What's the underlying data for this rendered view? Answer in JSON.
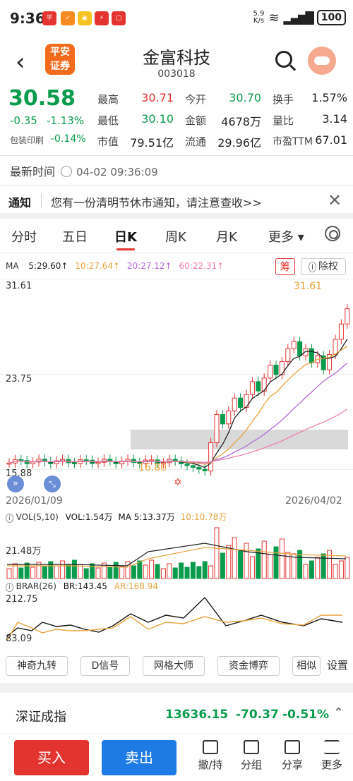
{
  "status": {
    "time": "9:36",
    "net": "5.9\nK/s",
    "battery": "100"
  },
  "header": {
    "logo": "平安\n证券",
    "title": "金富科技",
    "code": "003018"
  },
  "quote": {
    "price": "30.58",
    "change": "-0.35",
    "change_pct": "-1.13%",
    "wrap_label": "包装印刷",
    "wrap_value": "-0.14%",
    "fields": [
      {
        "label": "最高",
        "value": "30.71"
      },
      {
        "label": "今开",
        "value": "30.70"
      },
      {
        "label": "换手",
        "value": "1.57%"
      },
      {
        "label": "最低",
        "value": "30.10"
      },
      {
        "label": "金额",
        "value": "4678万"
      },
      {
        "label": "量比",
        "value": "3.14"
      },
      {
        "label": "市值",
        "value": "79.51亿"
      },
      {
        "label": "流通",
        "value": "29.96亿"
      },
      {
        "label": "市盈TTM",
        "value": "67.01"
      }
    ]
  },
  "latest": {
    "label": "最新时间",
    "value": "04-02 09:36:09"
  },
  "notice": {
    "tag": "通知",
    "text": "您有一份清明节休市通知，请注意查收>>"
  },
  "tabs": [
    "分时",
    "五日",
    "日K",
    "周K",
    "月K",
    "更多 ▾"
  ],
  "ma": {
    "label": "MA",
    "ma5": "5:29.60↑",
    "ma10": "10:27.64↑",
    "ma20": "20:27.12↑",
    "ma60": "60:22.31↑"
  },
  "chips": {
    "chou": "筹",
    "chuquan": "除权"
  },
  "kline": {
    "ymax": "31.61",
    "ymid": "23.75",
    "ymin": "15.88",
    "high_mark": "31.61",
    "low_mark": "16.80",
    "date_start": "2026/01/09",
    "date_end": "2026/04/02"
  },
  "vol": {
    "label": "VOL(5,10)",
    "vol": "VOL:1.54万",
    "ma5": "MA 5:13.37万",
    "ma10": "10:10.78万",
    "ytick": "21.48万"
  },
  "brar": {
    "label": "BRAR(26)",
    "br": "BR:143.45",
    "ar": "AR:168.94",
    "ymax": "212.75",
    "ymin": "83.09"
  },
  "tools": [
    "神奇九转",
    "D信号",
    "网格大师",
    "资金博弈",
    "相似",
    "设置"
  ],
  "index": {
    "name": "深证成指",
    "value": "13636.15",
    "change": "-70.37",
    "pct": "-0.51%"
  },
  "bottom": {
    "buy": "买入",
    "sell": "卖出",
    "items": [
      "撤/持",
      "分组",
      "分享",
      "更多"
    ]
  },
  "colors": {
    "up": "#e3342f",
    "down": "#0a9b4d",
    "ma5": "#222222",
    "ma10": "#e8a23a",
    "ma20": "#b46ad8",
    "ma60": "#ef7fb2"
  }
}
